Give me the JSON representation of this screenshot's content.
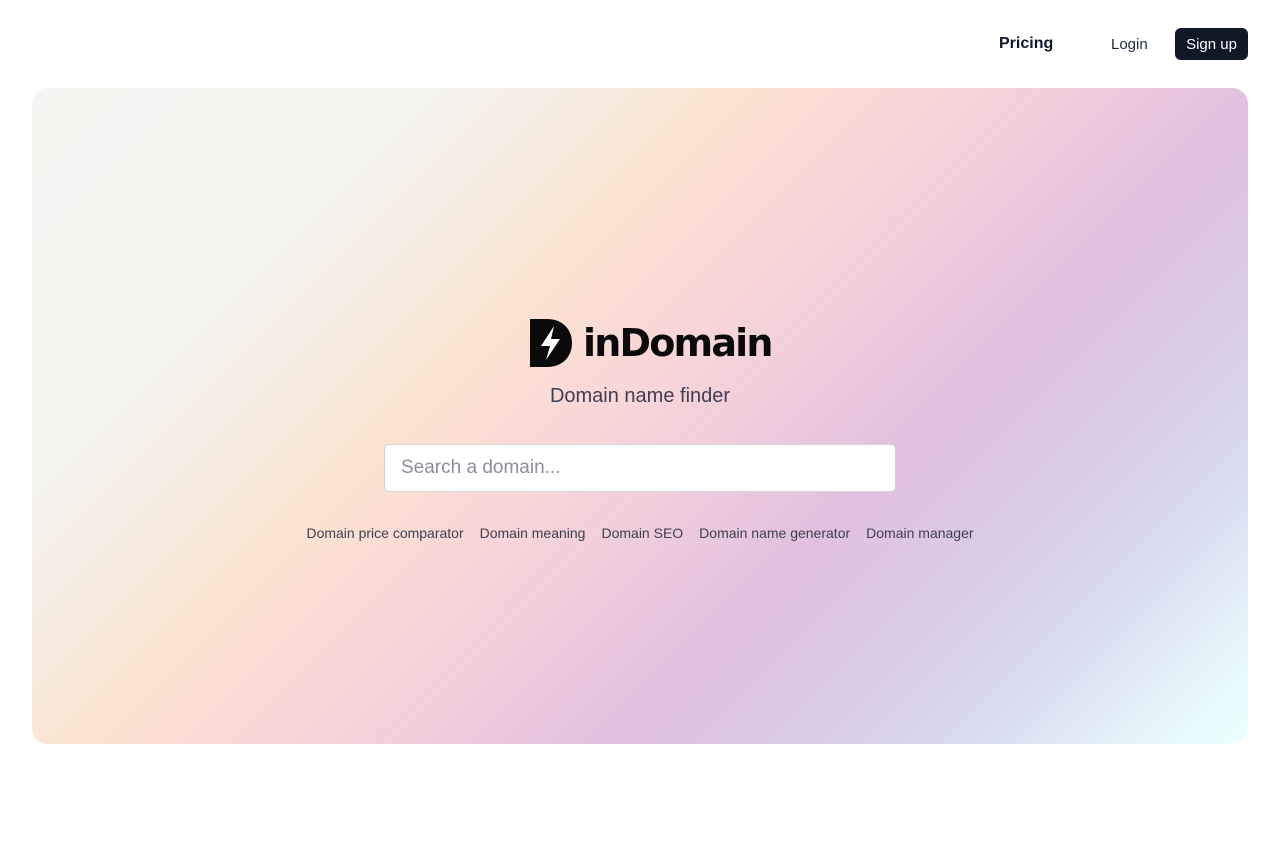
{
  "nav": {
    "pricing": "Pricing",
    "login": "Login",
    "signup": "Sign up"
  },
  "hero": {
    "logo_text": "inDomain",
    "logo_icon": "lightning-d-logo-icon",
    "tagline": "Domain name finder",
    "search_placeholder": "Search a domain...",
    "links": [
      "Domain price comparator",
      "Domain meaning",
      "Domain SEO",
      "Domain name generator",
      "Domain manager"
    ]
  },
  "colors": {
    "signup_bg": "#111827",
    "gradient_stops": [
      "#f4f6f3",
      "#fae3d0",
      "#f9d6d8",
      "#e1c0e0",
      "#d9dbf1",
      "#ebffff"
    ]
  }
}
